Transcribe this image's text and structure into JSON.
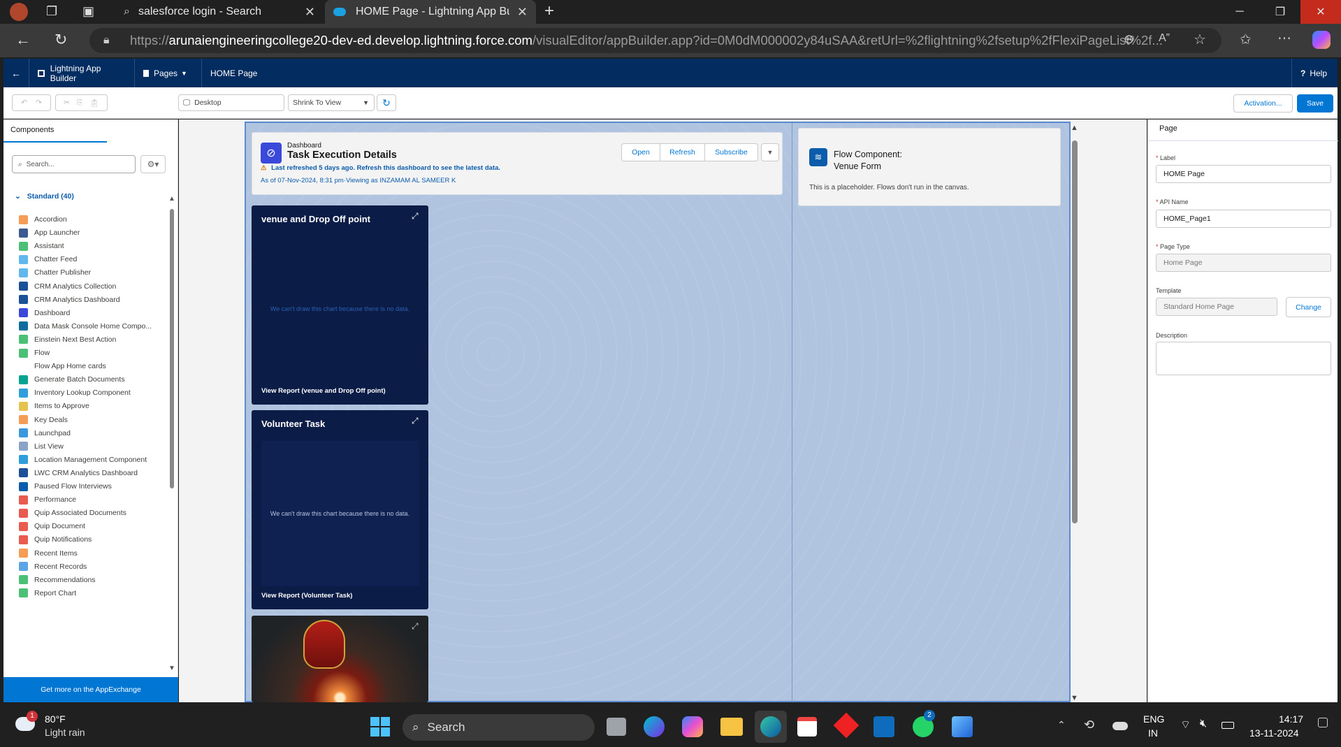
{
  "browser": {
    "tabs": [
      {
        "label": "salesforce login - Search"
      },
      {
        "label": "HOME Page - Lightning App Builder"
      }
    ],
    "url_prefix": "https://",
    "url_host": "arunaiengineeringcollege20-dev-ed.develop.lightning.force.com",
    "url_path": "/visualEditor/appBuilder.app?id=0M0dM000002y84uSAA&retUrl=%2flightning%2fsetup%2fFlexiPageList%2f..."
  },
  "sf_header": {
    "app_name": "Lightning App Builder",
    "pages_menu": "Pages",
    "page_name": "HOME Page",
    "help": "Help"
  },
  "toolbar": {
    "device": "Desktop",
    "view_mode": "Shrink To View",
    "activation": "Activation...",
    "save": "Save"
  },
  "components_panel": {
    "tab": "Components",
    "search_placeholder": "Search...",
    "section": "Standard (40)",
    "items": [
      {
        "label": "Accordion",
        "color": "#f59d54"
      },
      {
        "label": "App Launcher",
        "color": "#3c5c91"
      },
      {
        "label": "Assistant",
        "color": "#4bc076"
      },
      {
        "label": "Chatter Feed",
        "color": "#62b7ed"
      },
      {
        "label": "Chatter Publisher",
        "color": "#62b7ed"
      },
      {
        "label": "CRM Analytics Collection",
        "color": "#1b5297"
      },
      {
        "label": "CRM Analytics Dashboard",
        "color": "#1b5297"
      },
      {
        "label": "Dashboard",
        "color": "#3a49da"
      },
      {
        "label": "Data Mask Console Home Compo...",
        "color": "#0c6c9d"
      },
      {
        "label": "Einstein Next Best Action",
        "color": "#4bc076"
      },
      {
        "label": "Flow",
        "color": "#4bc076"
      },
      {
        "label": "Flow App Home cards",
        "color": ""
      },
      {
        "label": "Generate Batch Documents",
        "color": "#04a490"
      },
      {
        "label": "Inventory Lookup Component",
        "color": "#2f9edb"
      },
      {
        "label": "Items to Approve",
        "color": "#e6c34f"
      },
      {
        "label": "Key Deals",
        "color": "#f59d54"
      },
      {
        "label": "Launchpad",
        "color": "#3c97dd"
      },
      {
        "label": "List View",
        "color": "#8aa4c5"
      },
      {
        "label": "Location Management Component",
        "color": "#2f9edb"
      },
      {
        "label": "LWC CRM Analytics Dashboard",
        "color": "#1b5297"
      },
      {
        "label": "Paused Flow Interviews",
        "color": "#0b5cab"
      },
      {
        "label": "Performance",
        "color": "#e95a4f"
      },
      {
        "label": "Quip Associated Documents",
        "color": "#e95a4f"
      },
      {
        "label": "Quip Document",
        "color": "#e95a4f"
      },
      {
        "label": "Quip Notifications",
        "color": "#e95a4f"
      },
      {
        "label": "Recent Items",
        "color": "#f59d54"
      },
      {
        "label": "Recent Records",
        "color": "#5aa5e6"
      },
      {
        "label": "Recommendations",
        "color": "#4bc076"
      },
      {
        "label": "Report Chart",
        "color": "#4bc076"
      }
    ],
    "appexchange": "Get more on the AppExchange"
  },
  "dashboard": {
    "kicker": "Dashboard",
    "title": "Task Execution Details",
    "warning": "Last refreshed 5 days ago. Refresh this dashboard to see the latest data.",
    "asof": "As of 07-Nov-2024, 8:31 pm·Viewing as INZAMAM AL SAMEER K",
    "buttons": {
      "open": "Open",
      "refresh": "Refresh",
      "subscribe": "Subscribe"
    }
  },
  "cards": [
    {
      "title": "venue and Drop Off point",
      "nodata": "We can't draw this chart because there is no data.",
      "link": "View Report (venue and Drop Off point)"
    },
    {
      "title": "Volunteer Task",
      "nodata": "We can't draw this chart because there is no data.",
      "link": "View Report (Volunteer Task)"
    }
  ],
  "flow": {
    "title": "Flow Component:",
    "name": "Venue Form",
    "note": "This is a placeholder. Flows don't run in the canvas."
  },
  "properties": {
    "tab": "Page",
    "label_label": "Label",
    "label_value": "HOME Page",
    "api_label": "API Name",
    "api_value": "HOME_Page1",
    "type_label": "Page Type",
    "type_value": "Home Page",
    "template_label": "Template",
    "template_value": "Standard Home Page",
    "change": "Change",
    "description_label": "Description"
  },
  "taskbar": {
    "temp": "80°F",
    "weather": "Light rain",
    "weather_badge": "1",
    "search": "Search",
    "whatsapp_badge": "2",
    "lang1": "ENG",
    "lang2": "IN",
    "time": "14:17",
    "date": "13-11-2024"
  }
}
